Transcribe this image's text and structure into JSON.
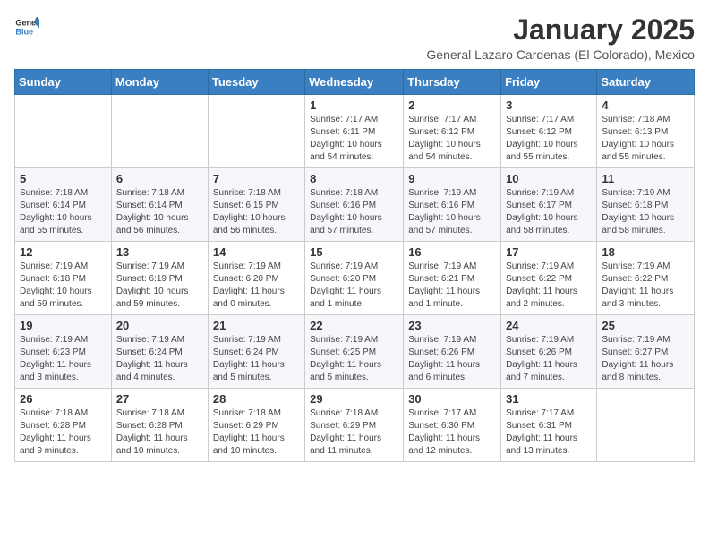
{
  "header": {
    "logo_general": "General",
    "logo_blue": "Blue",
    "month_title": "January 2025",
    "location": "General Lazaro Cardenas (El Colorado), Mexico"
  },
  "weekdays": [
    "Sunday",
    "Monday",
    "Tuesday",
    "Wednesday",
    "Thursday",
    "Friday",
    "Saturday"
  ],
  "weeks": [
    [
      {
        "day": "",
        "info": ""
      },
      {
        "day": "",
        "info": ""
      },
      {
        "day": "",
        "info": ""
      },
      {
        "day": "1",
        "info": "Sunrise: 7:17 AM\nSunset: 6:11 PM\nDaylight: 10 hours\nand 54 minutes."
      },
      {
        "day": "2",
        "info": "Sunrise: 7:17 AM\nSunset: 6:12 PM\nDaylight: 10 hours\nand 54 minutes."
      },
      {
        "day": "3",
        "info": "Sunrise: 7:17 AM\nSunset: 6:12 PM\nDaylight: 10 hours\nand 55 minutes."
      },
      {
        "day": "4",
        "info": "Sunrise: 7:18 AM\nSunset: 6:13 PM\nDaylight: 10 hours\nand 55 minutes."
      }
    ],
    [
      {
        "day": "5",
        "info": "Sunrise: 7:18 AM\nSunset: 6:14 PM\nDaylight: 10 hours\nand 55 minutes."
      },
      {
        "day": "6",
        "info": "Sunrise: 7:18 AM\nSunset: 6:14 PM\nDaylight: 10 hours\nand 56 minutes."
      },
      {
        "day": "7",
        "info": "Sunrise: 7:18 AM\nSunset: 6:15 PM\nDaylight: 10 hours\nand 56 minutes."
      },
      {
        "day": "8",
        "info": "Sunrise: 7:18 AM\nSunset: 6:16 PM\nDaylight: 10 hours\nand 57 minutes."
      },
      {
        "day": "9",
        "info": "Sunrise: 7:19 AM\nSunset: 6:16 PM\nDaylight: 10 hours\nand 57 minutes."
      },
      {
        "day": "10",
        "info": "Sunrise: 7:19 AM\nSunset: 6:17 PM\nDaylight: 10 hours\nand 58 minutes."
      },
      {
        "day": "11",
        "info": "Sunrise: 7:19 AM\nSunset: 6:18 PM\nDaylight: 10 hours\nand 58 minutes."
      }
    ],
    [
      {
        "day": "12",
        "info": "Sunrise: 7:19 AM\nSunset: 6:18 PM\nDaylight: 10 hours\nand 59 minutes."
      },
      {
        "day": "13",
        "info": "Sunrise: 7:19 AM\nSunset: 6:19 PM\nDaylight: 10 hours\nand 59 minutes."
      },
      {
        "day": "14",
        "info": "Sunrise: 7:19 AM\nSunset: 6:20 PM\nDaylight: 11 hours\nand 0 minutes."
      },
      {
        "day": "15",
        "info": "Sunrise: 7:19 AM\nSunset: 6:20 PM\nDaylight: 11 hours\nand 1 minute."
      },
      {
        "day": "16",
        "info": "Sunrise: 7:19 AM\nSunset: 6:21 PM\nDaylight: 11 hours\nand 1 minute."
      },
      {
        "day": "17",
        "info": "Sunrise: 7:19 AM\nSunset: 6:22 PM\nDaylight: 11 hours\nand 2 minutes."
      },
      {
        "day": "18",
        "info": "Sunrise: 7:19 AM\nSunset: 6:22 PM\nDaylight: 11 hours\nand 3 minutes."
      }
    ],
    [
      {
        "day": "19",
        "info": "Sunrise: 7:19 AM\nSunset: 6:23 PM\nDaylight: 11 hours\nand 3 minutes."
      },
      {
        "day": "20",
        "info": "Sunrise: 7:19 AM\nSunset: 6:24 PM\nDaylight: 11 hours\nand 4 minutes."
      },
      {
        "day": "21",
        "info": "Sunrise: 7:19 AM\nSunset: 6:24 PM\nDaylight: 11 hours\nand 5 minutes."
      },
      {
        "day": "22",
        "info": "Sunrise: 7:19 AM\nSunset: 6:25 PM\nDaylight: 11 hours\nand 5 minutes."
      },
      {
        "day": "23",
        "info": "Sunrise: 7:19 AM\nSunset: 6:26 PM\nDaylight: 11 hours\nand 6 minutes."
      },
      {
        "day": "24",
        "info": "Sunrise: 7:19 AM\nSunset: 6:26 PM\nDaylight: 11 hours\nand 7 minutes."
      },
      {
        "day": "25",
        "info": "Sunrise: 7:19 AM\nSunset: 6:27 PM\nDaylight: 11 hours\nand 8 minutes."
      }
    ],
    [
      {
        "day": "26",
        "info": "Sunrise: 7:18 AM\nSunset: 6:28 PM\nDaylight: 11 hours\nand 9 minutes."
      },
      {
        "day": "27",
        "info": "Sunrise: 7:18 AM\nSunset: 6:28 PM\nDaylight: 11 hours\nand 10 minutes."
      },
      {
        "day": "28",
        "info": "Sunrise: 7:18 AM\nSunset: 6:29 PM\nDaylight: 11 hours\nand 10 minutes."
      },
      {
        "day": "29",
        "info": "Sunrise: 7:18 AM\nSunset: 6:29 PM\nDaylight: 11 hours\nand 11 minutes."
      },
      {
        "day": "30",
        "info": "Sunrise: 7:17 AM\nSunset: 6:30 PM\nDaylight: 11 hours\nand 12 minutes."
      },
      {
        "day": "31",
        "info": "Sunrise: 7:17 AM\nSunset: 6:31 PM\nDaylight: 11 hours\nand 13 minutes."
      },
      {
        "day": "",
        "info": ""
      }
    ]
  ]
}
